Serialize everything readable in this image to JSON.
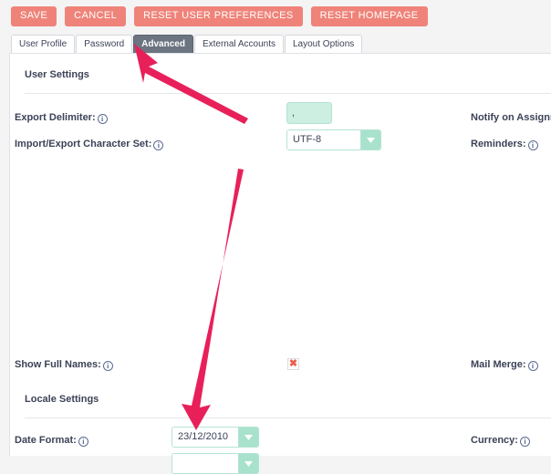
{
  "toolbar": {
    "buttons": [
      {
        "label": "SAVE",
        "name": "save-button"
      },
      {
        "label": "CANCEL",
        "name": "cancel-button"
      },
      {
        "label": "RESET USER PREFERENCES",
        "name": "reset-user-preferences-button"
      },
      {
        "label": "RESET HOMEPAGE",
        "name": "reset-homepage-button"
      }
    ]
  },
  "tabs": [
    {
      "label": "User Profile",
      "active": false
    },
    {
      "label": "Password",
      "active": false
    },
    {
      "label": "Advanced",
      "active": true
    },
    {
      "label": "External Accounts",
      "active": false
    },
    {
      "label": "Layout Options",
      "active": false
    }
  ],
  "sections": {
    "user_settings": "User Settings",
    "locale_settings": "Locale Settings"
  },
  "fields": {
    "export_delimiter": {
      "label": "Export Delimiter:",
      "value": ","
    },
    "import_export_charset": {
      "label": "Import/Export Character Set:",
      "value": "UTF-8"
    },
    "notify_on_assignment": {
      "label": "Notify on Assignment"
    },
    "reminders": {
      "label": "Reminders:"
    },
    "show_full_names": {
      "label": "Show Full Names:"
    },
    "mail_merge": {
      "label": "Mail Merge:"
    },
    "date_format": {
      "label": "Date Format:",
      "value": "23/12/2010"
    },
    "currency": {
      "label": "Currency:"
    }
  },
  "icons": {
    "info": "i",
    "broken_image": "✖",
    "dropdown_arrow": "chevron-down-icon"
  },
  "colors": {
    "button": "#ef8379",
    "active_tab": "#6b7480",
    "input_fill": "#ccefe1",
    "select_arrow": "#a8e2cd",
    "annotation_arrow": "#e8205a",
    "page_background": "#f4f4f5",
    "card_background": "#ffffff"
  },
  "annotations": [
    {
      "name": "arrow-to-advanced-tab",
      "points_at": "Advanced"
    },
    {
      "name": "arrow-to-date-format-select",
      "points_at": "Date Format"
    }
  ]
}
